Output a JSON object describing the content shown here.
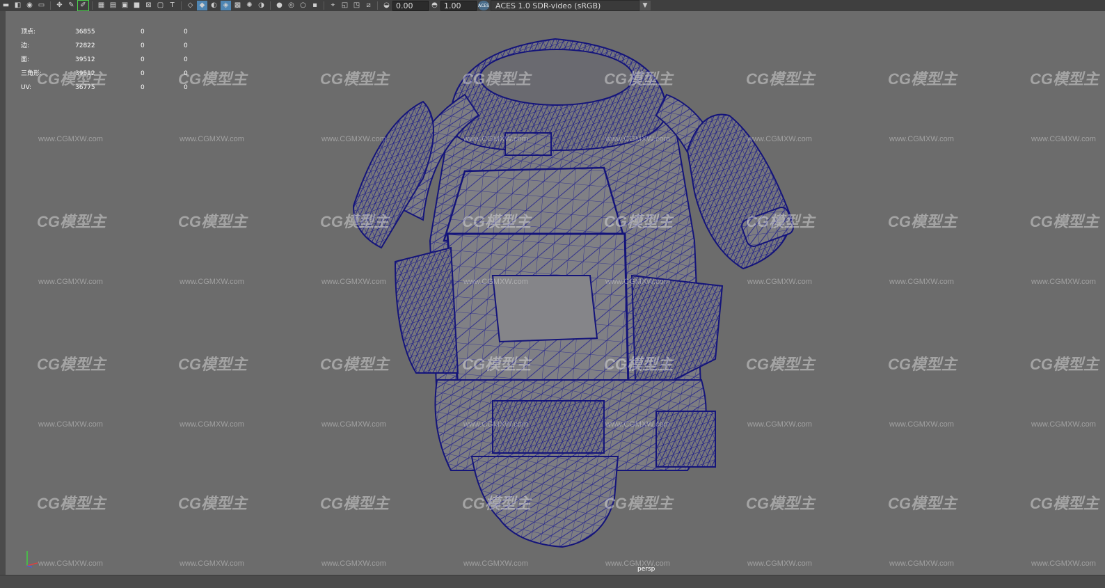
{
  "toolbar": {
    "icons": [
      "camera-icon",
      "bookmark-icon",
      "camera-attr-icon",
      "image-plane-icon",
      "pan-icon",
      "grease-pencil-icon",
      "grid-icon",
      "film-gate-icon",
      "resolution-gate-icon",
      "gate-mask-icon",
      "field-chart-icon",
      "safe-action-icon",
      "safe-title-icon",
      "wireframe-icon",
      "smooth-shade-icon",
      "default-material-icon",
      "wireframe-on-shaded-icon",
      "textured-icon",
      "lights-icon",
      "shadows-icon",
      "ambient-occlusion-icon",
      "motion-blur-icon",
      "anti-alias-icon",
      "depth-of-field-icon",
      "isolate-select-icon",
      "xray-icon",
      "xray-joints-icon",
      "backface-icon",
      "exposure-icon",
      "gamma-icon",
      "color-management-icon"
    ],
    "exposure_value": "0.00",
    "gamma_value": "1.00",
    "color_management_badge": "ACES",
    "color_space": "ACES 1.0 SDR-video (sRGB)",
    "dropdown_arrow": "▼"
  },
  "hud": {
    "rows": [
      {
        "label": "顶点:",
        "v1": "36855",
        "v2": "0",
        "v3": "0"
      },
      {
        "label": "边:",
        "v1": "72822",
        "v2": "0",
        "v3": "0"
      },
      {
        "label": "面:",
        "v1": "39512",
        "v2": "0",
        "v3": "0"
      },
      {
        "label": "三角形:",
        "v1": "39512",
        "v2": "0",
        "v3": "0"
      },
      {
        "label": "UV:",
        "v1": "36775",
        "v2": "0",
        "v3": "0"
      }
    ]
  },
  "watermark": {
    "logo": "CG模型主",
    "url": "www.CGMXW.com"
  },
  "camera_label": "persp",
  "axis": {
    "y": "Y",
    "z": "Z",
    "x": "X"
  },
  "colors": {
    "viewport_bg": "#6c6c6c",
    "wire": "#1c1c8c",
    "mesh_fill": "#7a7a7e",
    "toolbar_bg": "#3f3f3f",
    "active_button": "#4f86b3"
  }
}
